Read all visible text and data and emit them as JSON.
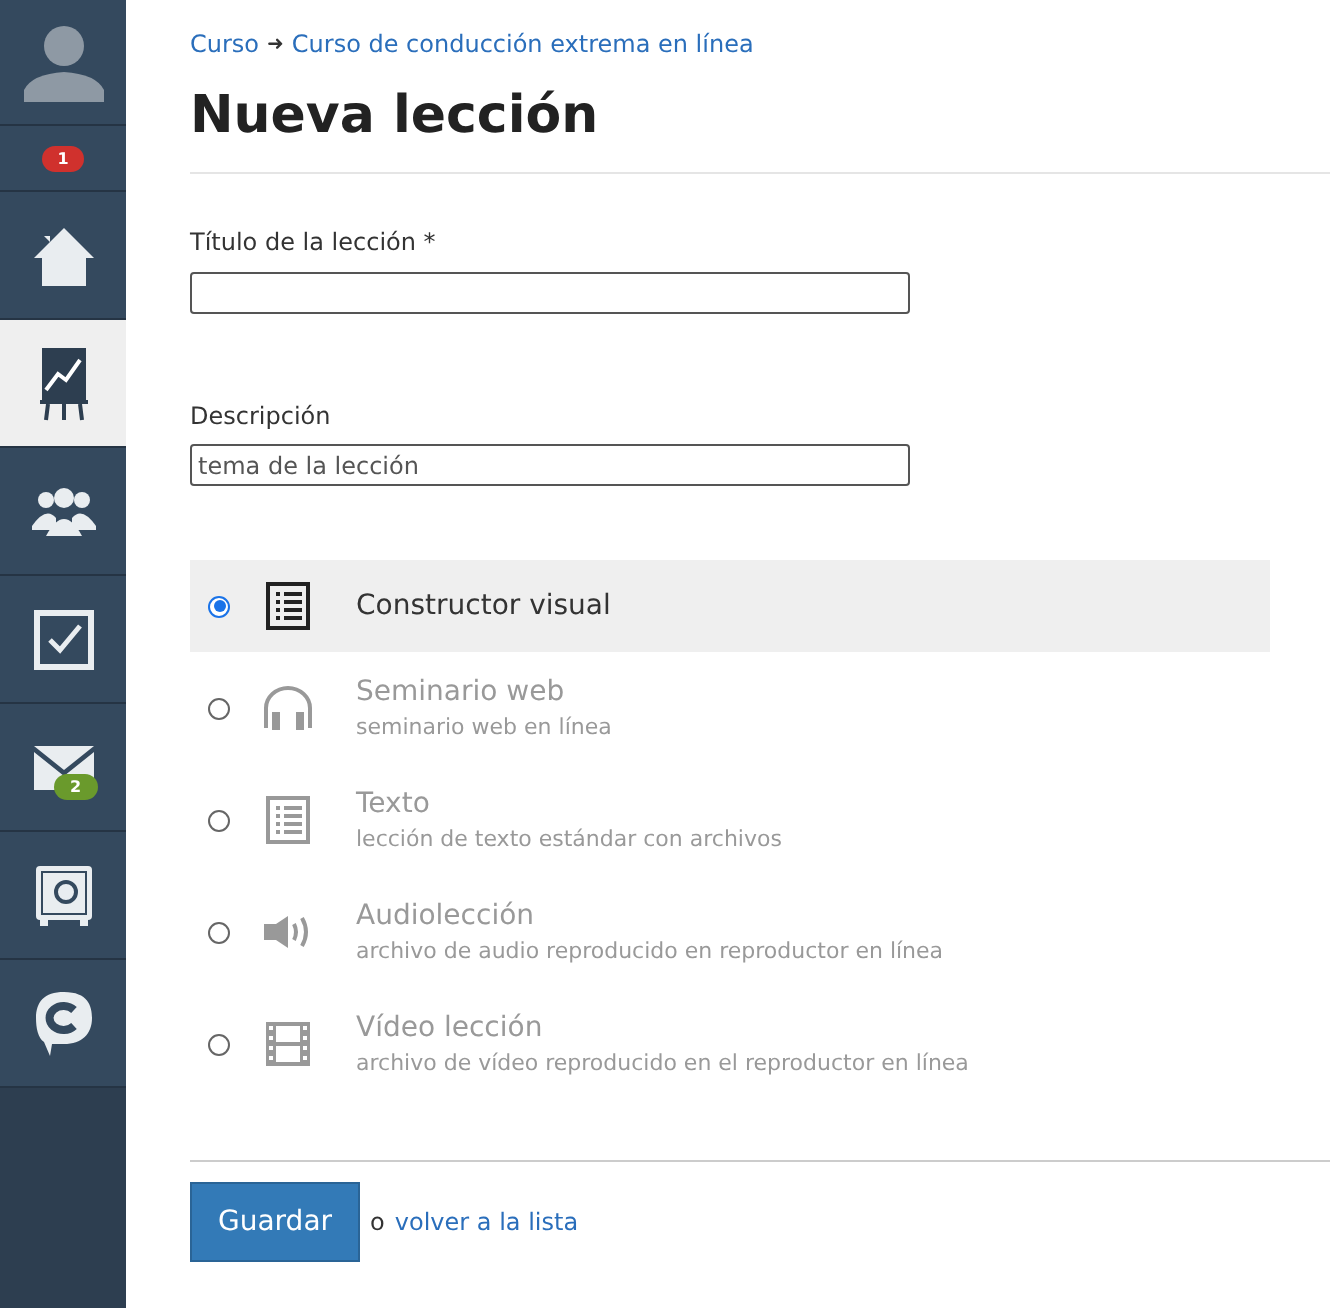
{
  "sidebar": {
    "notification_badge": "1",
    "items": [
      {
        "kind": "home",
        "selected": false
      },
      {
        "kind": "chart",
        "selected": true
      },
      {
        "kind": "people",
        "selected": false
      },
      {
        "kind": "check",
        "selected": false
      },
      {
        "kind": "mail",
        "selected": false,
        "badge": "2"
      },
      {
        "kind": "safe",
        "selected": false
      },
      {
        "kind": "chat",
        "selected": false
      }
    ]
  },
  "breadcrumb": [
    {
      "label": "Curso"
    },
    {
      "label": "Curso de conducción extrema en línea"
    }
  ],
  "breadcrumb_separator": "➜",
  "title": "Nueva lección",
  "fields": [
    {
      "label": "Título de la lección *"
    },
    {
      "label": "Descripción",
      "value": "tema de la lección"
    }
  ],
  "lesson_types": [
    {
      "kind": "builder",
      "title": "Constructor visual",
      "selected": true
    },
    {
      "kind": "webinar",
      "title": "Seminario web",
      "subtitle": "seminario web en línea",
      "selected": false
    },
    {
      "kind": "text",
      "title": "Texto",
      "subtitle": "lección de texto estándar con archivos",
      "selected": false
    },
    {
      "kind": "audio",
      "title": "Audiolección",
      "subtitle": "archivo de audio reproducido en reproductor en línea",
      "selected": false
    },
    {
      "kind": "video",
      "title": "Vídeo lección",
      "subtitle": "archivo de vídeo reproducido en el reproductor en línea",
      "selected": false
    }
  ],
  "save_button": "Guardar",
  "back_text": "o",
  "back_link": "volver a la lista"
}
